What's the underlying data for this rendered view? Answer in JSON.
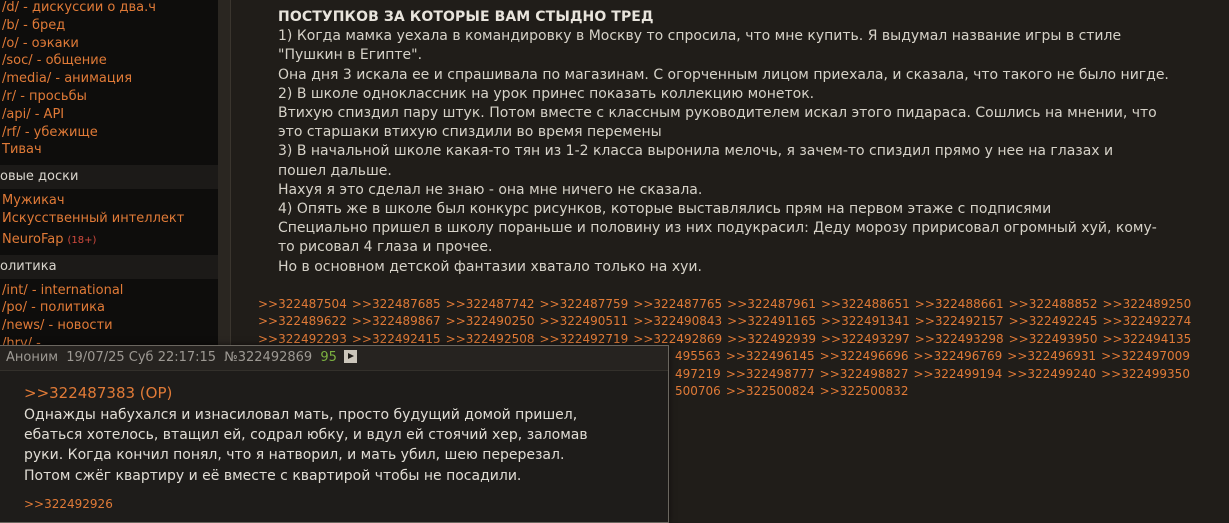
{
  "sidebar": {
    "section1": [
      {
        "label": "/d/ - дискуссии о два.ч"
      },
      {
        "label": "/b/ - бред"
      },
      {
        "label": "/o/ - оэкаки"
      },
      {
        "label": "/soc/ - общение"
      },
      {
        "label": "/media/ - анимация"
      },
      {
        "label": "/r/ - просьбы"
      },
      {
        "label": "/api/ - API"
      },
      {
        "label": "/rf/ - убежище"
      },
      {
        "label": "Тивач"
      }
    ],
    "header_new": "овые доски",
    "section2": [
      {
        "label": "Мужикач"
      },
      {
        "label": "Искусственный интеллект"
      },
      {
        "label": "NeuroFap",
        "badge": "(18+)"
      }
    ],
    "header_politics": "олитика",
    "section3": [
      {
        "label": "/int/ - international"
      },
      {
        "label": "/po/ - политика"
      },
      {
        "label": "/news/ - новости"
      },
      {
        "label": "/hry/ - ..."
      }
    ]
  },
  "post": {
    "subject": "ПОСТУПКОВ ЗА КОТОРЫЕ ВАМ СТЫДНО ТРЕД",
    "body": "1) Когда мамка уехала в командировку в Москву то спросила, что мне купить. Я выдумал название игры в стиле\n\"Пушкин в Египте\".\nОна дня 3 искала ее и спрашивала по магазинам. С огорченным лицом приехала, и сказала, что такого не было нигде.\n2) В школе одноклассник на урок принес показать коллекцию монеток.\nВтихую спиздил пару штук. Потом вместе с классным руководителем искал этого пидараса. Сошлись на мнении, что\nэто старшаки втихую спиздили во время перемены\n3) В начальной школе какая-то тян из 1-2 класса выронила мелочь, я зачем-то спиздил прямо у нее на глазах и\nпошел дальше.\nНахуя я это сделал не знаю - она мне ничего не сказала.\n4) Опять же в школе был конкурс рисунков, которые выставлялись прям на первом этаже с подписями\nСпециально пришел в школу пораньше и половину из них подукрасил: Деду морозу пририсовал огромный хуй, кому-\nто рисовал 4 глаза и прочее.\nНо в основном детской фантазии хватало только на хуи."
  },
  "replies": {
    "row1": [
      ">>322487504",
      ">>322487685",
      ">>322487742",
      ">>322487759",
      ">>322487765",
      ">>322487961",
      ">>322488651",
      ">>322488661",
      ">>322488852",
      ">>322489250"
    ],
    "row2": [
      ">>322489622",
      ">>322489867",
      ">>322490250",
      ">>322490511",
      ">>322490843",
      ">>322491165",
      ">>322491341",
      ">>322492157",
      ">>322492245",
      ">>322492274"
    ],
    "row3": [
      ">>322492293",
      ">>322492415",
      ">>322492508",
      ">>322492719",
      ">>322492869",
      ">>322492939",
      ">>322493297",
      ">>322493298",
      ">>322493950",
      ">>322494135"
    ],
    "row4_visible": [
      "495563",
      ">>322496145",
      ">>322496696",
      ">>322496769",
      ">>322496931",
      ">>322497009"
    ],
    "row5_visible": [
      "497219",
      ">>322498777",
      ">>322498827",
      ">>322499194",
      ">>322499240",
      ">>322499350"
    ],
    "row6_visible": [
      "500706",
      ">>322500824",
      ">>322500832"
    ]
  },
  "preview": {
    "author": "Аноним",
    "date": "19/07/25 Суб 22:17:15",
    "number": "№322492869",
    "count": "95",
    "quote": ">>322487383 (OP)",
    "text": "Однажды набухался и изнасиловал мать, просто будущий домой пришел,\nебаться хотелось, втащил ей, содрал юбку, и вдул ей стоячий хер, заломав\nруки. Когда кончил понял, что я натворил, и мать убил, шею перерезал.\nПотом сжёг квартиру и её вместе с квартирой чтобы не посадили.",
    "backlink": ">>322492926"
  }
}
